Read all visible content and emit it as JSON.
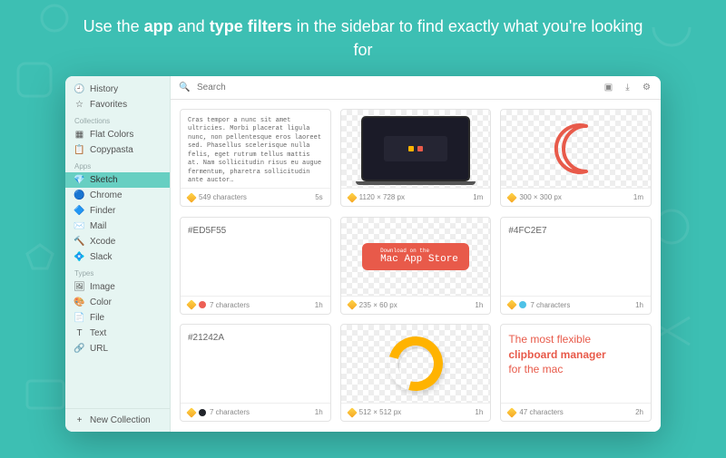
{
  "headline_parts": {
    "p1": "Use the ",
    "b1": "app",
    "p2": " and ",
    "b2": "type filters",
    "p3": " in the sidebar to find exactly what you're looking for"
  },
  "sidebar": {
    "top": [
      {
        "icon": "clock-icon",
        "glyph": "🕘",
        "label": "History"
      },
      {
        "icon": "star-icon",
        "glyph": "☆",
        "label": "Favorites"
      }
    ],
    "sections": [
      {
        "title": "Collections",
        "items": [
          {
            "icon": "palette-icon",
            "glyph": "▦",
            "label": "Flat Colors"
          },
          {
            "icon": "clipboard-icon",
            "glyph": "📋",
            "label": "Copypasta"
          }
        ]
      },
      {
        "title": "Apps",
        "items": [
          {
            "icon": "sketch-icon",
            "glyph": "💎",
            "label": "Sketch",
            "active": true
          },
          {
            "icon": "chrome-icon",
            "glyph": "🔵",
            "label": "Chrome"
          },
          {
            "icon": "finder-icon",
            "glyph": "🔷",
            "label": "Finder"
          },
          {
            "icon": "mail-icon",
            "glyph": "✉️",
            "label": "Mail"
          },
          {
            "icon": "xcode-icon",
            "glyph": "🔨",
            "label": "Xcode"
          },
          {
            "icon": "slack-icon",
            "glyph": "💠",
            "label": "Slack"
          }
        ]
      },
      {
        "title": "Types",
        "items": [
          {
            "icon": "image-icon",
            "glyph": "🖼",
            "label": "Image"
          },
          {
            "icon": "color-icon",
            "glyph": "🎨",
            "label": "Color"
          },
          {
            "icon": "file-icon",
            "glyph": "📄",
            "label": "File"
          },
          {
            "icon": "text-icon",
            "glyph": "T",
            "label": "Text"
          },
          {
            "icon": "url-icon",
            "glyph": "🔗",
            "label": "URL"
          }
        ]
      }
    ],
    "new_collection": "New Collection"
  },
  "toolbar": {
    "search_placeholder": "Search"
  },
  "cards": [
    {
      "kind": "text",
      "preview": "Cras tempor a nunc sit amet ultricies. Morbi placerat ligula nunc, non pellentesque eros laoreet sed. Phasellus scelerisque nulla felis, eget rutrum tellus mattis at. Nam sollicitudin risus eu augue fermentum, pharetra sollicitudin ante auctor…",
      "meta": "549 characters",
      "age": "5s"
    },
    {
      "kind": "image-laptop",
      "meta": "1120 × 728 px",
      "age": "1m"
    },
    {
      "kind": "image-crescent",
      "meta": "300 × 300 px",
      "age": "1m"
    },
    {
      "kind": "color",
      "hex": "#ED5F55",
      "meta": "7 characters",
      "age": "1h",
      "swatch": "#ED5F55"
    },
    {
      "kind": "image-appstore",
      "appstore_small": "Download on the",
      "appstore_big": "Mac App Store",
      "meta": "235 × 60 px",
      "age": "1h"
    },
    {
      "kind": "color",
      "hex": "#4FC2E7",
      "meta": "7 characters",
      "age": "1h",
      "swatch": "#4FC2E7"
    },
    {
      "kind": "color",
      "hex": "#21242A",
      "meta": "7 characters",
      "age": "1h",
      "swatch": "#21242A"
    },
    {
      "kind": "image-curl",
      "meta": "512 × 512 px",
      "age": "1h"
    },
    {
      "kind": "richtext",
      "line1": "The most flexible",
      "line2": "clipboard manager",
      "line3": "for the mac",
      "meta": "47 characters",
      "age": "2h"
    }
  ]
}
